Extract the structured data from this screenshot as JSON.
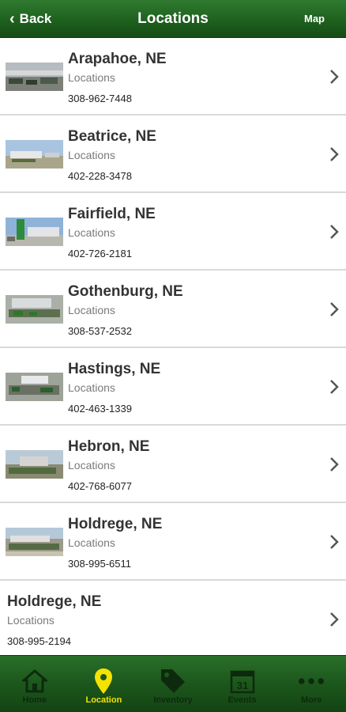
{
  "header": {
    "back_label": "Back",
    "title": "Locations",
    "map_label": "Map"
  },
  "locations": [
    {
      "name": "Arapahoe, NE",
      "category": "Locations",
      "phone": "308-962-7448"
    },
    {
      "name": "Beatrice, NE",
      "category": "Locations",
      "phone": "402-228-3478"
    },
    {
      "name": "Fairfield, NE",
      "category": "Locations",
      "phone": "402-726-2181"
    },
    {
      "name": "Gothenburg, NE",
      "category": "Locations",
      "phone": "308-537-2532"
    },
    {
      "name": "Hastings, NE",
      "category": "Locations",
      "phone": "402-463-1339"
    },
    {
      "name": "Hebron, NE",
      "category": "Locations",
      "phone": "402-768-6077"
    },
    {
      "name": "Holdrege, NE",
      "category": "Locations",
      "phone": "308-995-6511"
    },
    {
      "name": "Holdrege, NE",
      "category": "Locations",
      "phone": "308-995-2194"
    }
  ],
  "tabs": [
    {
      "label": "Home",
      "icon": "home-icon"
    },
    {
      "label": "Location",
      "icon": "location-pin-icon"
    },
    {
      "label": "Inventory",
      "icon": "tag-icon"
    },
    {
      "label": "Events",
      "icon": "calendar-icon",
      "calendar_day": "31"
    },
    {
      "label": "More",
      "icon": "more-dots-icon"
    }
  ],
  "colors": {
    "header_green": "#1d5e1d",
    "active_tab": "#f4e300",
    "tab_label": "#0e2a0e"
  }
}
